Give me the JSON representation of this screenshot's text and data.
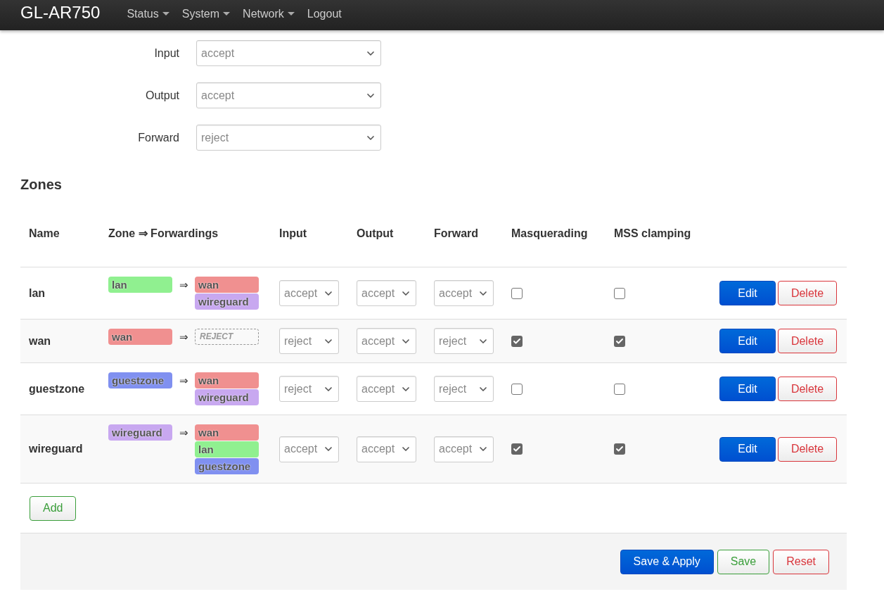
{
  "navbar": {
    "brand": "GL-AR750",
    "menu": [
      {
        "label": "Status",
        "dropdown": true
      },
      {
        "label": "System",
        "dropdown": true
      },
      {
        "label": "Network",
        "dropdown": true
      },
      {
        "label": "Logout",
        "dropdown": false
      }
    ]
  },
  "defaults": [
    {
      "label": "Input",
      "value": "accept"
    },
    {
      "label": "Output",
      "value": "accept"
    },
    {
      "label": "Forward",
      "value": "reject"
    }
  ],
  "zones": {
    "title": "Zones",
    "columns": [
      "Name",
      "Zone ⇒ Forwardings",
      "Input",
      "Output",
      "Forward",
      "Masquerading",
      "MSS clamping"
    ],
    "rows": [
      {
        "name": "lan",
        "source": {
          "label": "lan",
          "color": "#90f090"
        },
        "arrow": "⇒",
        "targets": [
          {
            "kind": "zone",
            "label": "wan",
            "color": "#f09090"
          },
          {
            "kind": "zone",
            "label": "wireguard",
            "color": "#c8a8f0"
          }
        ],
        "input": "accept",
        "output": "accept",
        "forward": "accept",
        "masquerading": false,
        "mss_clamping": false,
        "actions": [
          {
            "label": "Edit",
            "kind": "primary"
          },
          {
            "label": "Delete",
            "kind": "negative"
          }
        ]
      },
      {
        "name": "wan",
        "source": {
          "label": "wan",
          "color": "#f09090"
        },
        "arrow": "⇒",
        "targets": [
          {
            "kind": "policy",
            "label": "REJECT"
          }
        ],
        "input": "reject",
        "output": "accept",
        "forward": "reject",
        "masquerading": true,
        "mss_clamping": true,
        "actions": [
          {
            "label": "Edit",
            "kind": "primary"
          },
          {
            "label": "Delete",
            "kind": "negative"
          }
        ]
      },
      {
        "name": "guestzone",
        "source": {
          "label": "guestzone",
          "color": "#8090f0"
        },
        "arrow": "⇒",
        "targets": [
          {
            "kind": "zone",
            "label": "wan",
            "color": "#f09090"
          },
          {
            "kind": "zone",
            "label": "wireguard",
            "color": "#c8a8f0"
          }
        ],
        "input": "reject",
        "output": "accept",
        "forward": "reject",
        "masquerading": false,
        "mss_clamping": false,
        "actions": [
          {
            "label": "Edit",
            "kind": "primary"
          },
          {
            "label": "Delete",
            "kind": "negative"
          }
        ]
      },
      {
        "name": "wireguard",
        "source": {
          "label": "wireguard",
          "color": "#c8a8f0"
        },
        "arrow": "⇒",
        "targets": [
          {
            "kind": "zone",
            "label": "wan",
            "color": "#f09090"
          },
          {
            "kind": "zone",
            "label": "lan",
            "color": "#90f090"
          },
          {
            "kind": "zone",
            "label": "guestzone",
            "color": "#8090f0"
          }
        ],
        "input": "accept",
        "output": "accept",
        "forward": "accept",
        "masquerading": true,
        "mss_clamping": true,
        "actions": [
          {
            "label": "Edit",
            "kind": "primary"
          },
          {
            "label": "Delete",
            "kind": "negative"
          }
        ]
      }
    ]
  },
  "add_button": "Add",
  "footer_buttons": [
    {
      "label": "Save & Apply",
      "kind": "primary"
    },
    {
      "label": "Save",
      "kind": "positive"
    },
    {
      "label": "Reset",
      "kind": "negative"
    }
  ]
}
